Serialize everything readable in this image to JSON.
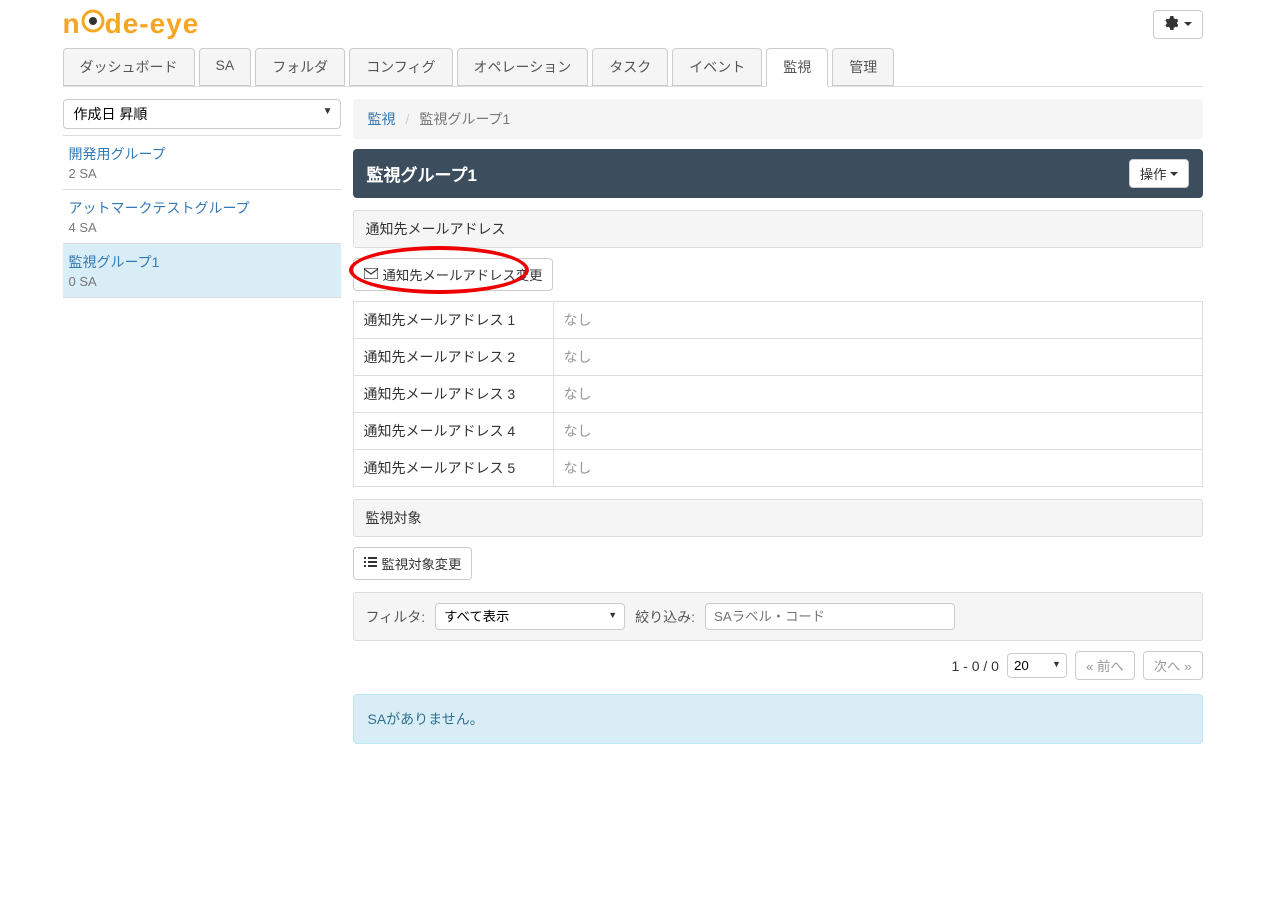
{
  "logo": {
    "text1": "n",
    "text2": "de-eye"
  },
  "nav": {
    "tabs": [
      {
        "label": "ダッシュボード"
      },
      {
        "label": "SA"
      },
      {
        "label": "フォルダ"
      },
      {
        "label": "コンフィグ"
      },
      {
        "label": "オペレーション"
      },
      {
        "label": "タスク"
      },
      {
        "label": "イベント"
      },
      {
        "label": "監視"
      },
      {
        "label": "管理"
      }
    ]
  },
  "sidebar": {
    "sort": "作成日 昇順",
    "groups": [
      {
        "name": "開発用グループ",
        "sub": "2 SA"
      },
      {
        "name": "アットマークテストグループ",
        "sub": "4 SA"
      },
      {
        "name": "監視グループ1",
        "sub": "0 SA"
      }
    ]
  },
  "breadcrumb": {
    "root": "監視",
    "current": "監視グループ1"
  },
  "title": "監視グループ1",
  "action_label": "操作",
  "mail_panel": {
    "header": "通知先メールアドレス",
    "change_btn": "通知先メールアドレス変更",
    "rows": [
      {
        "label": "通知先メールアドレス 1",
        "value": "なし"
      },
      {
        "label": "通知先メールアドレス 2",
        "value": "なし"
      },
      {
        "label": "通知先メールアドレス 3",
        "value": "なし"
      },
      {
        "label": "通知先メールアドレス 4",
        "value": "なし"
      },
      {
        "label": "通知先メールアドレス 5",
        "value": "なし"
      }
    ]
  },
  "target_panel": {
    "header": "監視対象",
    "change_btn": "監視対象変更"
  },
  "filter": {
    "label": "フィルタ:",
    "select": "すべて表示",
    "narrow_label": "絞り込み:",
    "placeholder": "SAラベル・コード"
  },
  "pagination": {
    "info": "1 - 0 / 0",
    "size": "20",
    "prev": "« 前へ",
    "next": "次へ »"
  },
  "alert": "SAがありません。"
}
